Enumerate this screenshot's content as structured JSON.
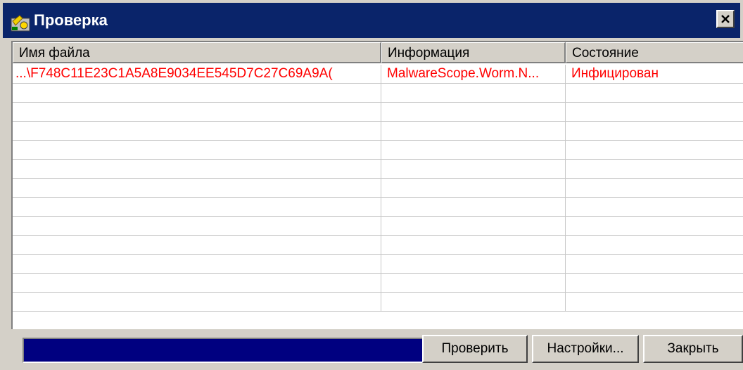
{
  "window": {
    "title": "Проверка"
  },
  "table": {
    "columns": [
      "Имя файла",
      "Информация",
      "Состояние"
    ],
    "rows": [
      {
        "file": "...\\F748C11E23C1A5A8E9034EE545D7C27C69A9A(",
        "info": "MalwareScope.Worm.N...",
        "status": "Инфицирован"
      }
    ],
    "empty_row_count": 12
  },
  "progress": {
    "fraction": 1.0
  },
  "buttons": {
    "scan": "Проверить",
    "settings": "Настройки...",
    "close": "Закрыть"
  },
  "colors": {
    "titlebar": "#0a246a",
    "infected_text": "#ff0000",
    "progress_fill": "#000080"
  },
  "icons": {
    "title_icon": "scan-app-icon",
    "close_icon": "close-x-icon"
  }
}
